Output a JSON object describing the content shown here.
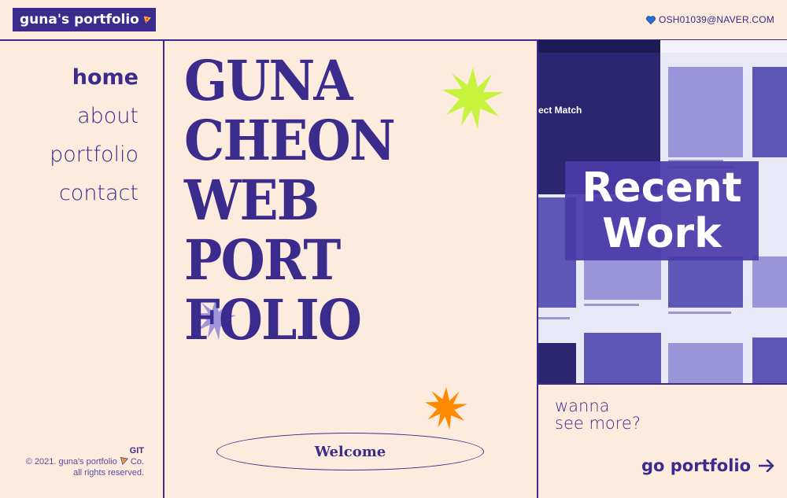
{
  "header": {
    "logo_text": "guna's portfolio",
    "email": "OSH01039@NAVER.COM"
  },
  "nav": {
    "items": [
      "home",
      "about",
      "portfolio",
      "contact"
    ],
    "active": "home"
  },
  "footer": {
    "git": "GIT",
    "copyright_line1": "© 2021. guna's portfolio",
    "copyright_co": "Co.",
    "copyright_line2": "all rights reserved."
  },
  "hero": {
    "lines": [
      "GUNA",
      "CHEON",
      "WEB",
      "PORT",
      "FOLIO"
    ],
    "welcome_label": "Welcome"
  },
  "recent": {
    "thumb_caption": "ect Match",
    "label_line1": "Recent",
    "label_line2": "Work"
  },
  "cta": {
    "wanna_line1": "wanna",
    "wanna_line2": "see more?",
    "go_label": "go portfolio"
  },
  "colors": {
    "background": "#fdebdd",
    "primary": "#3a2b8c",
    "lime_star": "#c6f43c",
    "orange_star": "#ff8a00",
    "lavender_star": "#9f95dd"
  },
  "icons": [
    "pizza-icon",
    "heart-icon",
    "arrow-right-icon",
    "star-burst-icon"
  ]
}
